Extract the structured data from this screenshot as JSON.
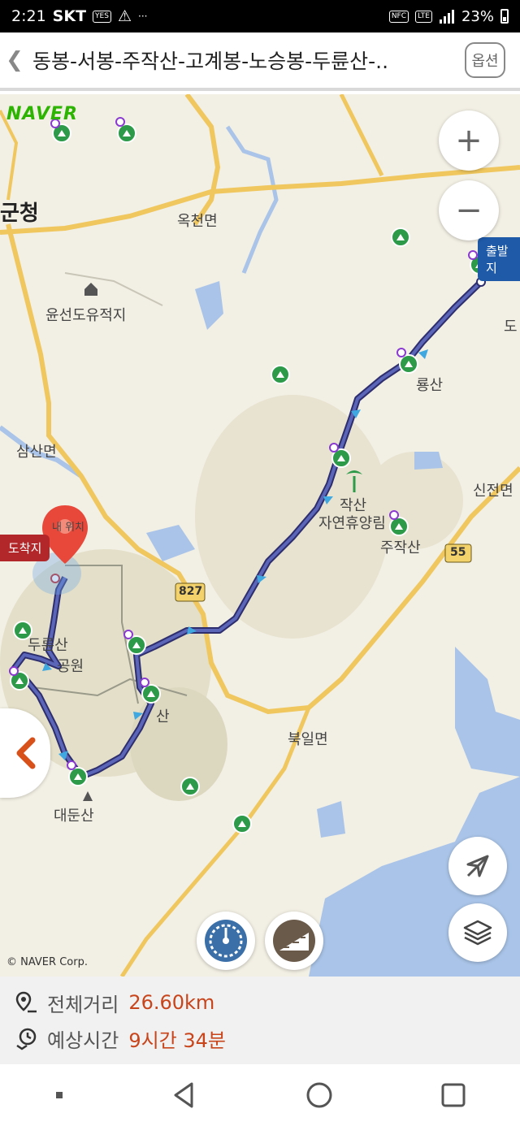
{
  "status_bar": {
    "time": "2:21",
    "carrier": "SKT",
    "battery": "23%",
    "extra": "···"
  },
  "header": {
    "back_icon": "chevron-left-icon",
    "title": "동봉-서봉-주작산-고계봉-노승봉-두륜산-..",
    "options_label": "옵션"
  },
  "map": {
    "logo": "NAVER",
    "copyright": "© NAVER Corp.",
    "labels": {
      "gun": "군청",
      "okcheon": "옥천면",
      "yunseon": "윤선도유적지",
      "samsan": "삼산면",
      "ryungsan": "룡산",
      "jujak_forest": "작산",
      "jujak_forest2": "자연휴양림",
      "jujak": "주작산",
      "sinjeon": "신전면",
      "road55": "55",
      "road827": "827",
      "dure1": "두륜산",
      "dure2": "공원",
      "gosan": "산",
      "daedun": "대둔산",
      "bugil": "북일면",
      "do": "도",
      "my_location": "내 위치"
    },
    "start_flag": "출발지",
    "end_flag": "도착지",
    "route_color": "#4a55a8",
    "zoom_in": "+",
    "zoom_out": "−"
  },
  "info": {
    "distance_label": "전체거리",
    "distance_value": "26.60km",
    "time_label": "예상시간",
    "time_value": "9시간 34분"
  }
}
